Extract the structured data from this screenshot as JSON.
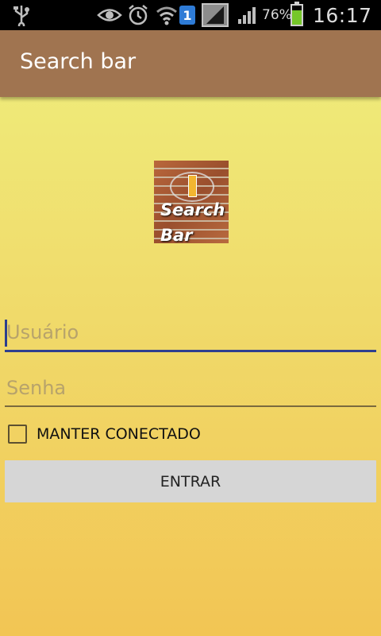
{
  "status_bar": {
    "battery_percent": "76%",
    "time": "16:17",
    "sim_number": "1",
    "icons": [
      "usb-icon",
      "eye-icon",
      "alarm-icon",
      "wifi-icon",
      "sim-icon",
      "mobile-data-icon",
      "signal-icon",
      "battery-icon"
    ]
  },
  "action_bar": {
    "title": "Search bar",
    "color": "#a07450"
  },
  "logo": {
    "line1": "Search",
    "line2": "Bar"
  },
  "form": {
    "username_placeholder": "Usuário",
    "password_placeholder": "Senha",
    "remember_label": "MANTER CONECTADO",
    "submit_label": "ENTRAR"
  }
}
